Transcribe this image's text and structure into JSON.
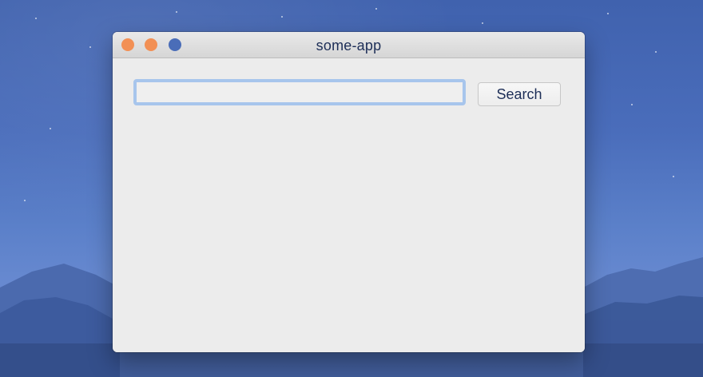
{
  "window": {
    "title": "some-app",
    "controls": {
      "close": {
        "icon": "close-icon",
        "color": "#f29055"
      },
      "minimize": {
        "icon": "minimize-icon",
        "color": "#f29055"
      },
      "zoom": {
        "icon": "zoom-icon",
        "color": "#4a6db8"
      }
    }
  },
  "search": {
    "value": "",
    "placeholder": "",
    "button_label": "Search"
  },
  "colors": {
    "accent": "#a7c5ec",
    "title_text": "#1d2e57",
    "window_bg": "#ececec"
  }
}
